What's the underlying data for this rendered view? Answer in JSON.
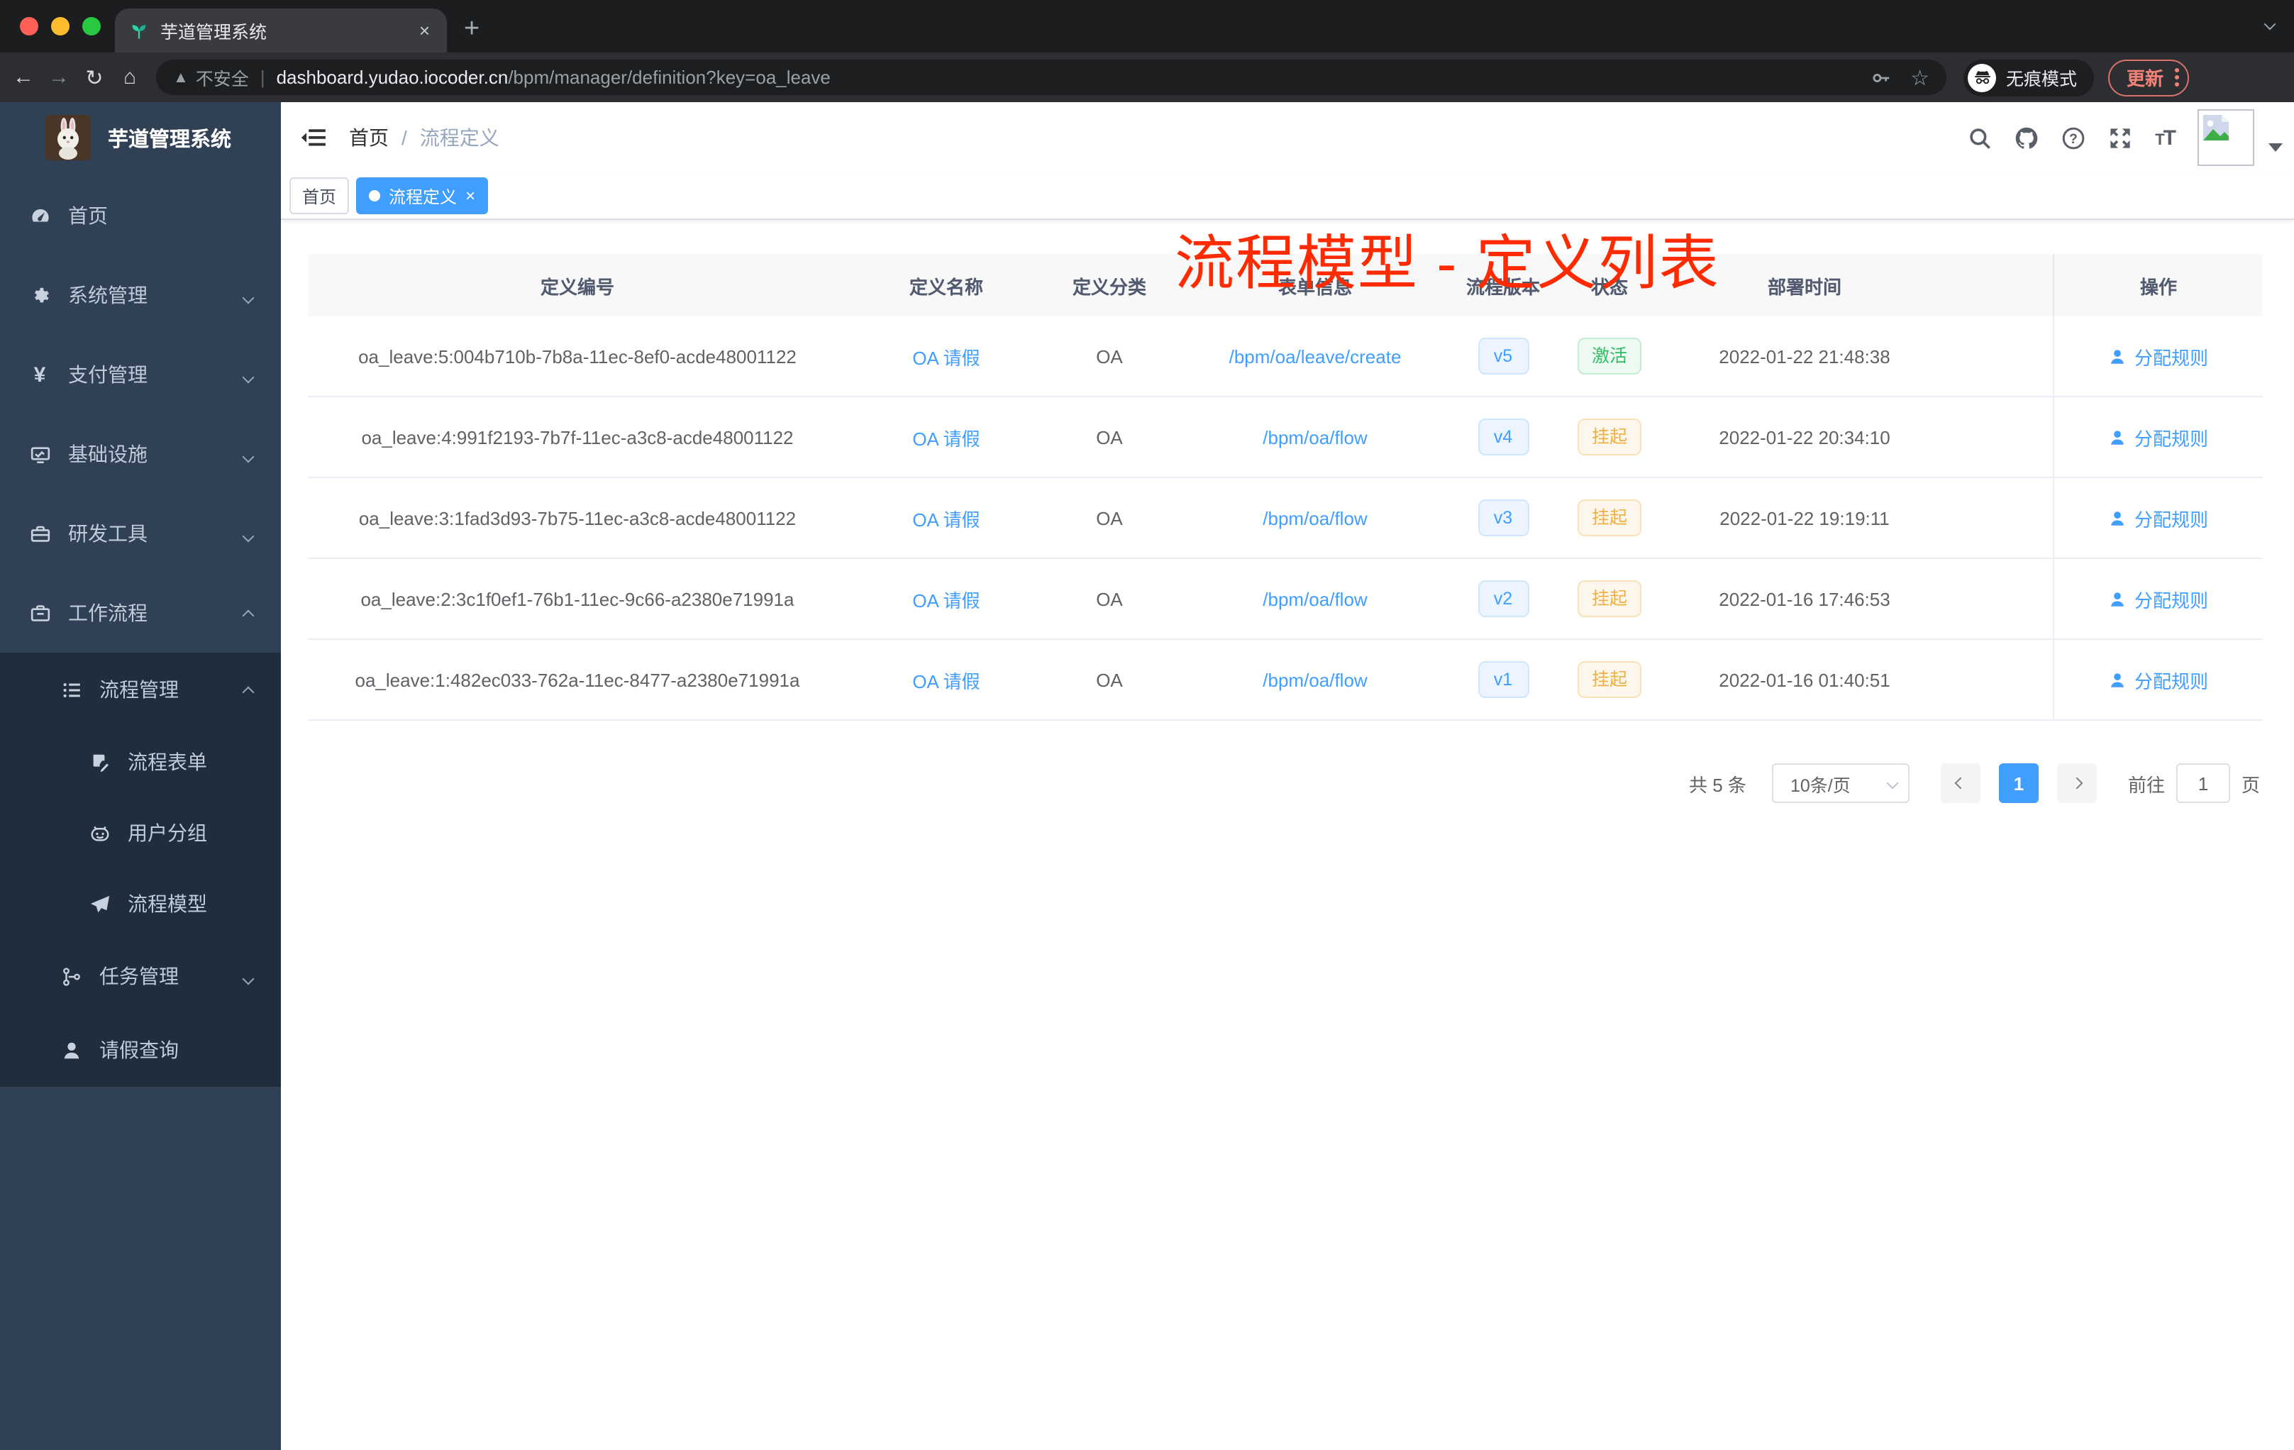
{
  "browser": {
    "tab": {
      "title": "芋道管理系统",
      "close_glyph": "×",
      "new_tab_glyph": "+"
    },
    "nav": {
      "back_glyph": "←",
      "forward_glyph": "→",
      "reload_glyph": "↻",
      "home_glyph": "⌂"
    },
    "omnibox": {
      "warning_glyph": "▲",
      "security_label": "不安全",
      "separator": "|",
      "url_host": "dashboard.yudao.iocoder.cn",
      "url_path": "/bpm/manager/definition?key=oa_leave"
    },
    "incognito_label": "无痕模式",
    "update_button": "更新"
  },
  "annotation": {
    "text": "流程模型 - 定义列表"
  },
  "sidebar": {
    "brand": "芋道管理系统",
    "menu": [
      "首页",
      "系统管理",
      "支付管理",
      "基础设施",
      "研发工具",
      "工作流程"
    ],
    "submenu": {
      "manage": "流程管理",
      "children": [
        "流程表单",
        "用户分组",
        "流程模型"
      ],
      "task": "任务管理",
      "leave": "请假查询"
    }
  },
  "header": {
    "breadcrumb_home": "首页",
    "breadcrumb_sep": "/",
    "breadcrumb_current": "流程定义"
  },
  "tags": {
    "home": "首页",
    "current": "流程定义",
    "close_glyph": "×"
  },
  "table": {
    "columns": [
      "定义编号",
      "定义名称",
      "定义分类",
      "表单信息",
      "流程版本",
      "状态",
      "部署时间",
      "操作"
    ],
    "action_label": "分配规则",
    "rows": [
      {
        "id": "oa_leave:5:004b710b-7b8a-11ec-8ef0-acde48001122",
        "name": "OA 请假",
        "category": "OA",
        "form": "/bpm/oa/leave/create",
        "version": "v5",
        "status": "激活",
        "status_type": "success",
        "deploy_time": "2022-01-22 21:48:38"
      },
      {
        "id": "oa_leave:4:991f2193-7b7f-11ec-a3c8-acde48001122",
        "name": "OA 请假",
        "category": "OA",
        "form": "/bpm/oa/flow",
        "version": "v4",
        "status": "挂起",
        "status_type": "warning",
        "deploy_time": "2022-01-22 20:34:10"
      },
      {
        "id": "oa_leave:3:1fad3d93-7b75-11ec-a3c8-acde48001122",
        "name": "OA 请假",
        "category": "OA",
        "form": "/bpm/oa/flow",
        "version": "v3",
        "status": "挂起",
        "status_type": "warning",
        "deploy_time": "2022-01-22 19:19:11"
      },
      {
        "id": "oa_leave:2:3c1f0ef1-76b1-11ec-9c66-a2380e71991a",
        "name": "OA 请假",
        "category": "OA",
        "form": "/bpm/oa/flow",
        "version": "v2",
        "status": "挂起",
        "status_type": "warning",
        "deploy_time": "2022-01-16 17:46:53"
      },
      {
        "id": "oa_leave:1:482ec033-762a-11ec-8477-a2380e71991a",
        "name": "OA 请假",
        "category": "OA",
        "form": "/bpm/oa/flow",
        "version": "v1",
        "status": "挂起",
        "status_type": "warning",
        "deploy_time": "2022-01-16 01:40:51"
      }
    ]
  },
  "pagination": {
    "total_label": "共 5 条",
    "page_size": "10条/页",
    "current_page": "1",
    "goto_label": "前往",
    "goto_value": "1",
    "page_unit": "页"
  },
  "colors": {
    "accent": "#409eff",
    "sidebar_bg": "#304156",
    "submenu_bg": "#1f2d3d",
    "sidebar_text": "#bfcbd9",
    "success": "#2fbd64",
    "warning": "#eeb041",
    "annotation_red": "#ff2a00",
    "update_button_red": "#ee8279",
    "table_header_bg": "#f8f8f9",
    "row_border": "#ebeef5"
  },
  "icons": {
    "favicon": "seedling-icon",
    "toolbar": [
      "search-icon",
      "github-icon",
      "question-icon",
      "fullscreen-icon",
      "font-size-icon"
    ],
    "menu": [
      "dashboard-icon",
      "gear-icon",
      "yen-icon",
      "monitor-icon",
      "toolbox-icon",
      "briefcase-icon",
      "list-icon",
      "form-icon",
      "group-icon",
      "send-icon",
      "tree-icon",
      "user-icon"
    ],
    "action": "user-icon"
  }
}
